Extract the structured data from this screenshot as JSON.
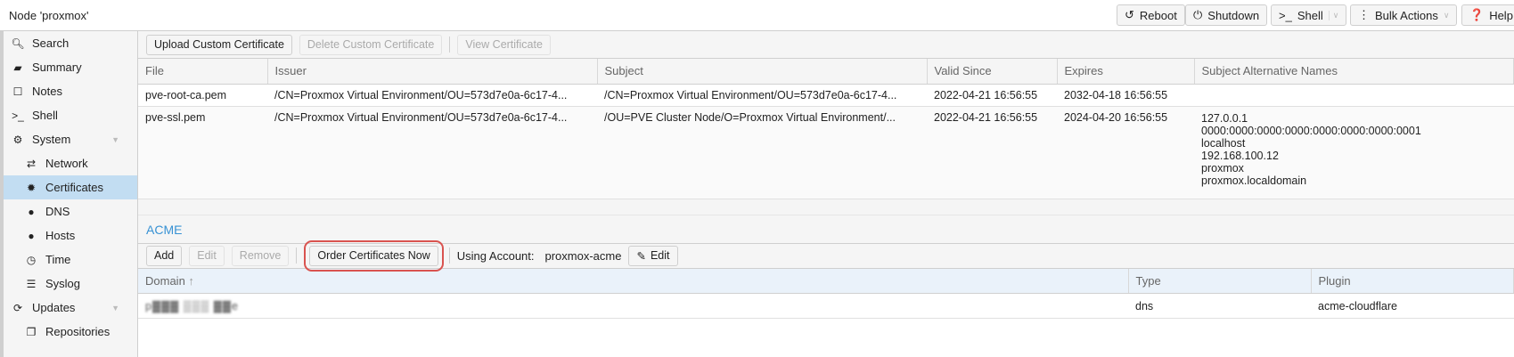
{
  "header": {
    "title": "Node 'proxmox'",
    "buttons": [
      {
        "label": "Reboot",
        "icon": "undo-icon"
      },
      {
        "label": "Shutdown",
        "icon": "power-icon"
      },
      {
        "label": "Shell",
        "icon": "terminal-icon"
      },
      {
        "label": "Bulk Actions",
        "icon": "ellipsis-vertical-icon"
      },
      {
        "label": "Help",
        "icon": "question-circle-icon"
      }
    ]
  },
  "sidebar": {
    "items": [
      {
        "label": "Search",
        "icon": "search-icon"
      },
      {
        "label": "Summary",
        "icon": "book-icon"
      },
      {
        "label": "Notes",
        "icon": "sticky-note-icon"
      },
      {
        "label": "Shell",
        "icon": "terminal-icon"
      },
      {
        "label": "System",
        "icon": "cogs-icon"
      },
      {
        "label": "Network",
        "icon": "exchange-icon"
      },
      {
        "label": "Certificates",
        "icon": "certificate-icon"
      },
      {
        "label": "DNS",
        "icon": "globe-icon"
      },
      {
        "label": "Hosts",
        "icon": "globe-icon"
      },
      {
        "label": "Time",
        "icon": "clock-icon"
      },
      {
        "label": "Syslog",
        "icon": "list-icon"
      },
      {
        "label": "Updates",
        "icon": "refresh-icon"
      },
      {
        "label": "Repositories",
        "icon": "files-icon"
      }
    ],
    "selected": "Certificates"
  },
  "certificates": {
    "toolbar": {
      "upload": "Upload Custom Certificate",
      "delete": "Delete Custom Certificate",
      "view": "View Certificate"
    },
    "columns": [
      "File",
      "Issuer",
      "Subject",
      "Valid Since",
      "Expires",
      "Subject Alternative Names"
    ],
    "rows": [
      {
        "file": "pve-root-ca.pem",
        "issuer": "/CN=Proxmox Virtual Environment/OU=573d7e0a-6c17-4...",
        "subject": "/CN=Proxmox Virtual Environment/OU=573d7e0a-6c17-4...",
        "valid_since": "2022-04-21 16:56:55",
        "expires": "2032-04-18 16:56:55",
        "san": []
      },
      {
        "file": "pve-ssl.pem",
        "issuer": "/CN=Proxmox Virtual Environment/OU=573d7e0a-6c17-4...",
        "subject": "/OU=PVE Cluster Node/O=Proxmox Virtual Environment/...",
        "valid_since": "2022-04-21 16:56:55",
        "expires": "2024-04-20 16:56:55",
        "san": [
          "127.0.0.1",
          "0000:0000:0000:0000:0000:0000:0000:0001",
          "localhost",
          "192.168.100.12",
          "proxmox",
          "proxmox.localdomain"
        ]
      }
    ]
  },
  "acme": {
    "title": "ACME",
    "toolbar": {
      "add": "Add",
      "edit": "Edit",
      "remove": "Remove",
      "order": "Order Certificates Now",
      "account_label": "Using Account:",
      "account": "proxmox-acme",
      "edit_account": "Edit"
    },
    "columns": [
      "Domain",
      "Type",
      "Plugin"
    ],
    "sort_indicator": "↑",
    "rows": [
      {
        "domain": "p▓▓▓ ▒▒▒ ▓▓e",
        "type": "dns",
        "plugin": "acme-cloudflare"
      }
    ]
  },
  "colors": {
    "accent": "#3892d4",
    "selected": "#c2ddf2",
    "highlight": "#d9534f"
  }
}
